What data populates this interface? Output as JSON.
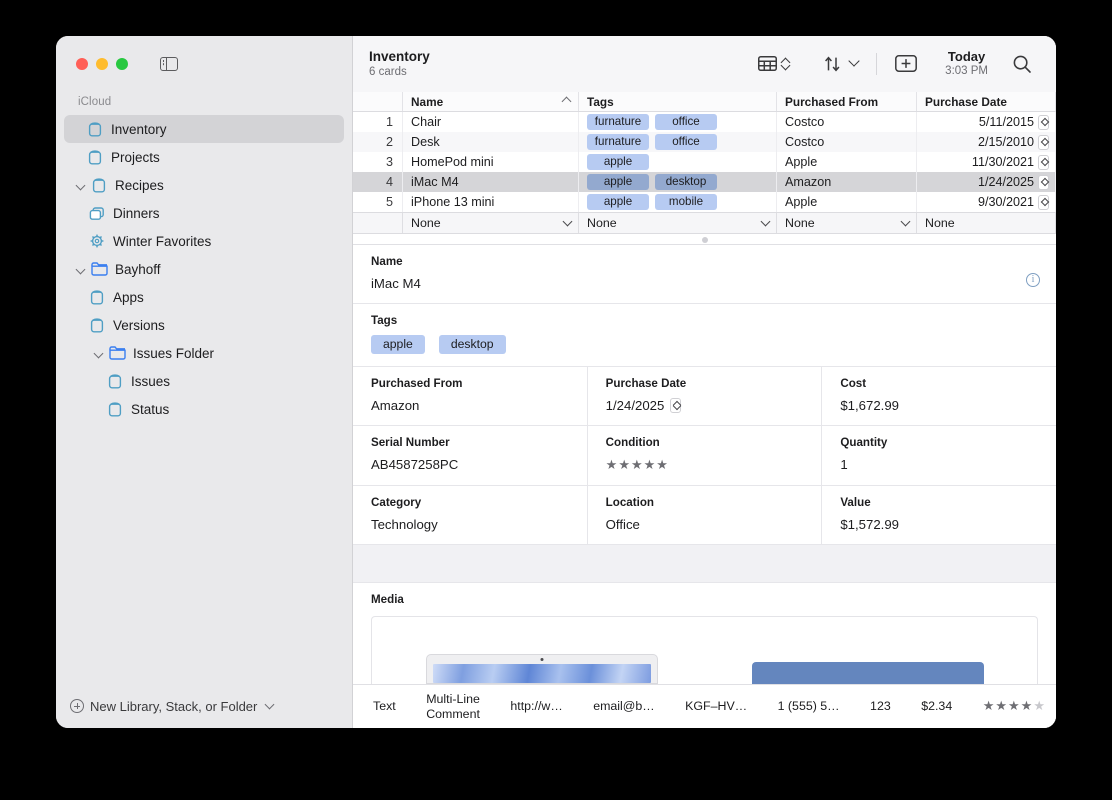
{
  "sidebar": {
    "section_label": "iCloud",
    "items": [
      {
        "label": "Inventory",
        "icon": "library-icon",
        "indent": 0,
        "selected": true,
        "twisty": "none"
      },
      {
        "label": "Projects",
        "icon": "library-icon",
        "indent": 0,
        "selected": false,
        "twisty": "none"
      },
      {
        "label": "Recipes",
        "icon": "library-icon",
        "indent": 0,
        "selected": false,
        "twisty": "open"
      },
      {
        "label": "Dinners",
        "icon": "stack-icon",
        "indent": 1,
        "selected": false,
        "twisty": "none"
      },
      {
        "label": "Winter Favorites",
        "icon": "gear-icon",
        "indent": 1,
        "selected": false,
        "twisty": "none"
      },
      {
        "label": "Bayhoff",
        "icon": "folder-icon",
        "indent": 0,
        "selected": false,
        "twisty": "open"
      },
      {
        "label": "Apps",
        "icon": "library-icon",
        "indent": 1,
        "selected": false,
        "twisty": "none"
      },
      {
        "label": "Versions",
        "icon": "library-icon",
        "indent": 1,
        "selected": false,
        "twisty": "none"
      },
      {
        "label": "Issues Folder",
        "icon": "folder-icon",
        "indent": 1,
        "selected": false,
        "twisty": "open"
      },
      {
        "label": "Issues",
        "icon": "library-icon",
        "indent": 2,
        "selected": false,
        "twisty": "none"
      },
      {
        "label": "Status",
        "icon": "library-icon",
        "indent": 2,
        "selected": false,
        "twisty": "none"
      }
    ],
    "footer_label": "New Library, Stack, or Folder"
  },
  "toolbar": {
    "title": "Inventory",
    "subtitle": "6 cards",
    "view_icon": "table-view-icon",
    "sort_icon": "sort-arrows-icon",
    "add_icon": "add-card-icon",
    "date_label": "Today",
    "time_label": "3:03 PM",
    "search_icon": "search-icon"
  },
  "table": {
    "columns": [
      "",
      "Name",
      "Tags",
      "Purchased From",
      "Purchase Date"
    ],
    "sort_column": "Name",
    "rows": [
      {
        "num": "1",
        "name": "Chair",
        "tags": [
          "furnature",
          "office"
        ],
        "from": "Costco",
        "date": "5/11/2015",
        "selected": false
      },
      {
        "num": "2",
        "name": "Desk",
        "tags": [
          "furnature",
          "office"
        ],
        "from": "Costco",
        "date": "2/15/2010",
        "selected": false
      },
      {
        "num": "3",
        "name": "HomePod mini",
        "tags": [
          "apple"
        ],
        "from": "Apple",
        "date": "11/30/2021",
        "selected": false
      },
      {
        "num": "4",
        "name": "iMac M4",
        "tags": [
          "apple",
          "desktop"
        ],
        "from": "Amazon",
        "date": "1/24/2025",
        "selected": true
      },
      {
        "num": "5",
        "name": "iPhone 13 mini",
        "tags": [
          "apple",
          "mobile"
        ],
        "from": "Apple",
        "date": "9/30/2021",
        "selected": false
      }
    ],
    "summary_row": [
      "None",
      "None",
      "None",
      "None"
    ]
  },
  "detail": {
    "name_label": "Name",
    "name_value": "iMac M4",
    "info_icon": "info-circle-icon",
    "tags_label": "Tags",
    "tags_values": [
      "apple",
      "desktop"
    ],
    "fields": [
      {
        "label": "Purchased From",
        "value": "Amazon",
        "type": "text"
      },
      {
        "label": "Purchase Date",
        "value": "1/24/2025",
        "type": "date"
      },
      {
        "label": "Cost",
        "value": "$1,672.99",
        "type": "text"
      },
      {
        "label": "Serial Number",
        "value": "AB4587258PC",
        "type": "text"
      },
      {
        "label": "Condition",
        "value": "",
        "type": "rating",
        "rating": 5,
        "max": 5
      },
      {
        "label": "Quantity",
        "value": "1",
        "type": "text"
      },
      {
        "label": "Category",
        "value": "Technology",
        "type": "text"
      },
      {
        "label": "Location",
        "value": "Office",
        "type": "text"
      },
      {
        "label": "Value",
        "value": "$1,572.99",
        "type": "text"
      }
    ],
    "media_label": "Media"
  },
  "bottombar": {
    "items": [
      {
        "label": "Text",
        "lines": [
          "Text"
        ]
      },
      {
        "label": "Multi-Line Comment",
        "lines": [
          "Multi-Line",
          "Comment"
        ]
      },
      {
        "label": "http://w…",
        "lines": [
          "http://w…"
        ]
      },
      {
        "label": "email@b…",
        "lines": [
          "email@b…"
        ]
      },
      {
        "label": "KGF–HV…",
        "lines": [
          "KGF–HV…"
        ]
      },
      {
        "label": "1 (555) 5…",
        "lines": [
          "1 (555) 5…"
        ]
      },
      {
        "label": "123",
        "lines": [
          "123"
        ]
      },
      {
        "label": "$2.34",
        "lines": [
          "$2.34"
        ]
      }
    ],
    "rating": 4,
    "rating_max": 5
  },
  "colors": {
    "accent_tag": "#b7cbf2",
    "accent_tag_selected": "#93a9cf",
    "sidebar_bg": "#e9e9eb",
    "selected_row": "#d5d5d8",
    "icon_blue": "#4f9ec4",
    "folder_blue": "#3b7ff0"
  }
}
